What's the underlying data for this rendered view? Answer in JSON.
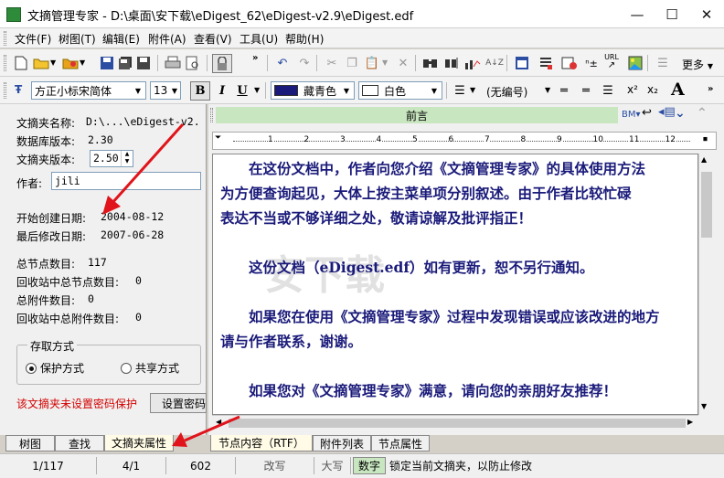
{
  "window": {
    "title": "文摘管理专家 - D:\\桌面\\安下载\\eDigest_62\\eDigest-v2.9\\eDigest.edf",
    "minimize": "—",
    "maximize": "☐",
    "close": "✕"
  },
  "menu": [
    "文件(F)",
    "树图(T)",
    "编辑(E)",
    "附件(A)",
    "查看(V)",
    "工具(U)",
    "帮助(H)"
  ],
  "toolbar": {
    "more_label": "更多",
    "url_label": "URL"
  },
  "format_bar": {
    "font_name": "方正小标宋简体",
    "font_size": "13",
    "bold": "B",
    "italic": "I",
    "underline": "U",
    "font_color_label": "藏青色",
    "font_color": "#1a1a7a",
    "bg_color_label": "白色",
    "numbering": "(无编号)",
    "superscript": "x²",
    "subscript": "x₂",
    "grow_font": "A"
  },
  "left_panel": {
    "name_label": "文摘夹名称:",
    "name_value": "D:\\...\\eDigest-v2.",
    "db_version_label": "数据库版本:",
    "db_version_value": "2.30",
    "folder_version_label": "文摘夹版本:",
    "folder_version_value": "2.50",
    "author_label": "作者:",
    "author_value": "jili",
    "created_label": "开始创建日期:",
    "created_value": "2004-08-12",
    "modified_label": "最后修改日期:",
    "modified_value": "2007-06-28",
    "total_nodes_label": "总节点数目:",
    "total_nodes_value": "117",
    "recycle_nodes_label": "回收站中总节点数目:",
    "recycle_nodes_value": "0",
    "total_attach_label": "总附件数目:",
    "total_attach_value": "0",
    "recycle_attach_label": "回收站中总附件数目:",
    "recycle_attach_value": "0",
    "storage_group_label": "存取方式",
    "protect_mode_label": "保护方式",
    "share_mode_label": "共享方式",
    "password_warning": "该文摘夹未设置密码保护",
    "set_password_button": "设置密码",
    "warning_color": "#d40000"
  },
  "left_tabs": [
    "树图",
    "查找",
    "文摘夹属性"
  ],
  "right_panel": {
    "node_title": "前言",
    "bm_label": "BM",
    "ruler_numbers": [
      "1",
      "2",
      "3",
      "4",
      "5",
      "6",
      "7",
      "8",
      "9",
      "10",
      "11",
      "12"
    ],
    "paragraphs": [
      "　　在这份文档中，作者向您介绍《文摘管理专家》的具体使用方法",
      "为方便查询起见，大体上按主菜单项分别叙述。由于作者比较忙碌",
      "表达不当或不够详细之处，敬请谅解及批评指正！",
      "",
      "　　这份文档（eDigest.edf）如有更新，恕不另行通知。",
      "",
      "　　如果您在使用《文摘管理专家》过程中发现错误或应该改进的地方",
      "请与作者联系，谢谢。",
      "",
      "　　如果您对《文摘管理专家》满意，请向您的亲朋好友推荐！"
    ]
  },
  "right_tabs": [
    "节点内容（RTF）",
    "附件列表",
    "节点属性"
  ],
  "status_bar": {
    "position": "1/117",
    "page": "4/1",
    "count": "602",
    "overwrite": "改写",
    "caps": "大写",
    "numlock": "数字",
    "message": "锁定当前文摘夹，以防止修改"
  },
  "watermark_text": "安下载",
  "annotation_color": "#e0141a"
}
